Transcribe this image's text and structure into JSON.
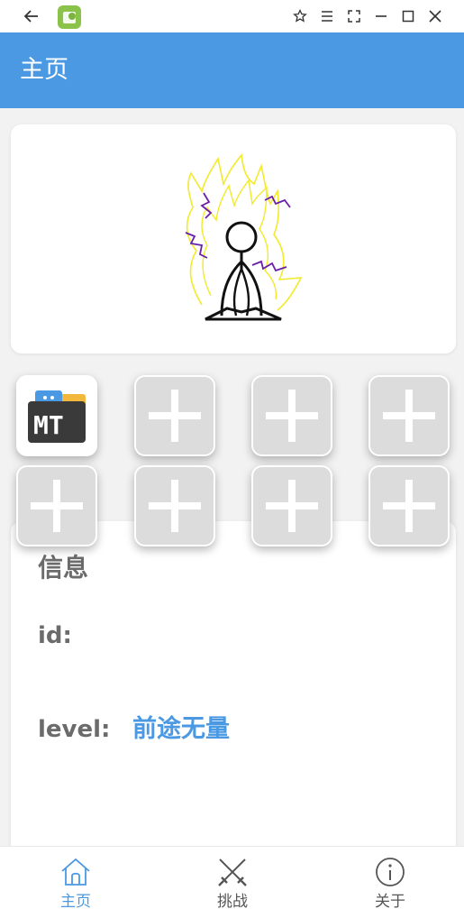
{
  "window": {
    "back_icon": "arrow-left-icon",
    "app_icon": "android-app-icon",
    "controls": [
      "pin-icon",
      "menu-icon",
      "fullscreen-icon",
      "minimize-icon",
      "maximize-icon",
      "close-icon"
    ]
  },
  "appbar": {
    "title": "主页",
    "color": "#4a99e2"
  },
  "hero": {
    "image": "stick-figure-meditating-aura-icon"
  },
  "tiles": [
    {
      "type": "app",
      "label": "MT",
      "icon": "mt-manager-icon"
    },
    {
      "type": "add",
      "icon": "plus-icon"
    },
    {
      "type": "add",
      "icon": "plus-icon"
    },
    {
      "type": "add",
      "icon": "plus-icon"
    },
    {
      "type": "add",
      "icon": "plus-icon"
    },
    {
      "type": "add",
      "icon": "plus-icon"
    },
    {
      "type": "add",
      "icon": "plus-icon"
    },
    {
      "type": "add",
      "icon": "plus-icon"
    }
  ],
  "info": {
    "title": "信息",
    "id_label": "id:",
    "id_value": "",
    "level_label": "level:",
    "level_value": "前途无量"
  },
  "bottom_nav": {
    "active_color": "#4a99e2",
    "items": [
      {
        "label": "主页",
        "icon": "home-icon",
        "active": true
      },
      {
        "label": "挑战",
        "icon": "crossed-swords-icon",
        "active": false
      },
      {
        "label": "关于",
        "icon": "info-icon",
        "active": false
      }
    ]
  }
}
